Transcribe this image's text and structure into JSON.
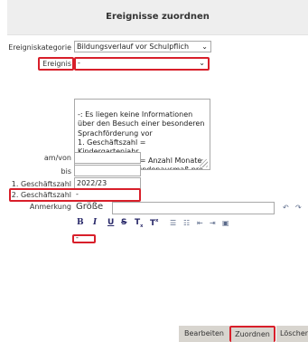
{
  "dialog": {
    "title": "Ereignisse zuordnen"
  },
  "form": {
    "ereigniskategorie": {
      "label": "Ereigniskategorie",
      "value": "Bildungsverlauf vor Schulpflich"
    },
    "ereignis": {
      "label": "Ereignis",
      "value": "-"
    },
    "description": "-: Es liegen keine Informationen über den Besuch einer besonderen Sprachförderung vor\n1. Geschäftszahl = Kindergartenjahr\n2. Geschäftszahl = Anzahl Monate\nAnmerkung = Stundenausmaß pro Woche",
    "am_von": {
      "label": "am/von",
      "value": ""
    },
    "bis": {
      "label": "bis",
      "value": ""
    },
    "gz1": {
      "label": "1. Geschäftszahl",
      "value": "2022/23"
    },
    "gz2": {
      "label": "2. Geschäftszahl",
      "value": "-"
    },
    "anmerkung": {
      "label": "Anmerkung"
    }
  },
  "editor": {
    "size_label": "Größe",
    "bold": "B",
    "italic": "I",
    "underline": "U",
    "strike": "S",
    "subscript": "T",
    "superscript": "T",
    "content": "-"
  },
  "buttons": {
    "bearbeiten": "Bearbeiten",
    "zuordnen": "Zuordnen",
    "loeschen": "Löschen"
  },
  "colors": {
    "highlight": "#d81f2a",
    "titlebar": "#eeeeee",
    "button": "#d8d5cf"
  }
}
